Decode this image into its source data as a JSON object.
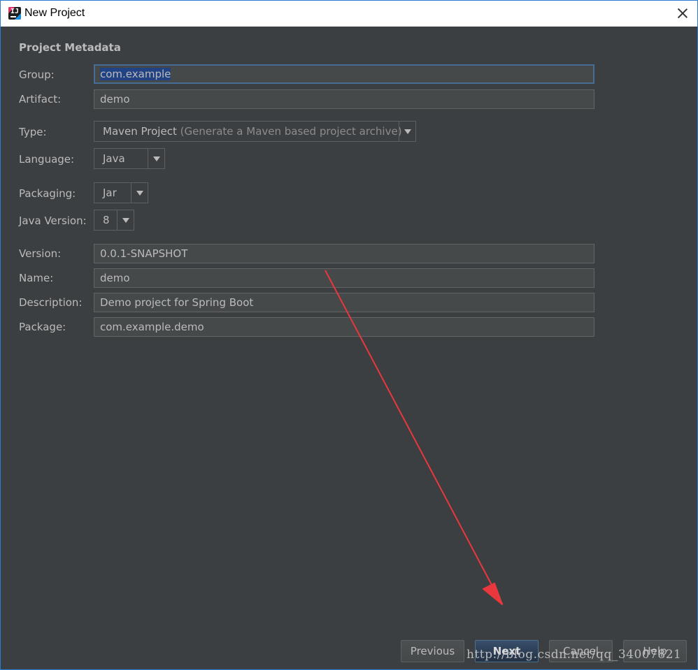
{
  "window": {
    "title": "New Project"
  },
  "section": {
    "title": "Project Metadata"
  },
  "fields": {
    "group": {
      "label": "Group:",
      "value": "com.example"
    },
    "artifact": {
      "label": "Artifact:",
      "value": "demo"
    },
    "version": {
      "label": "Version:",
      "value": "0.0.1-SNAPSHOT"
    },
    "name": {
      "label": "Name:",
      "value": "demo"
    },
    "description": {
      "label": "Description:",
      "value": "Demo project for Spring Boot"
    },
    "package": {
      "label": "Package:",
      "value": "com.example.demo"
    }
  },
  "combos": {
    "type": {
      "label": "Type:",
      "value": "Maven Project",
      "hint": "(Generate a Maven based project archive)"
    },
    "language": {
      "label": "Language:",
      "value": "Java"
    },
    "packaging": {
      "label": "Packaging:",
      "value": "Jar"
    },
    "java_version": {
      "label": "Java Version:",
      "value": "8"
    }
  },
  "buttons": {
    "previous": "Previous",
    "next": "Next",
    "cancel": "Cancel",
    "help": "Help"
  },
  "watermark": "http://blog.csdn.net/qq_34007821",
  "colors": {
    "background": "#3c3f41",
    "selection": "#214283",
    "annotation_arrow": "#e8383d"
  }
}
